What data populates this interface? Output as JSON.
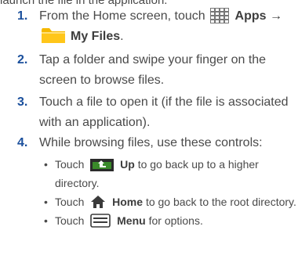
{
  "top_partial_line": "launch the file in the application.",
  "steps": [
    {
      "number": "1.",
      "text_before": "From the Home screen, touch",
      "apps_label": "Apps",
      "arrow": "→",
      "folder_label": "My Files",
      "folder_suffix": "."
    },
    {
      "number": "2.",
      "text": "Tap a folder and swipe your finger on the screen to browse files."
    },
    {
      "number": "3.",
      "text": "Touch a file to open it (if the file is associated with an application)."
    },
    {
      "number": "4.",
      "text": "While browsing files, use these controls:",
      "controls": [
        {
          "bullet": "•",
          "prefix": "Touch",
          "label": "Up",
          "text": "to go back up to a higher directory.",
          "icon": "up-folder-icon"
        },
        {
          "bullet": "•",
          "prefix": "Touch",
          "label": "Home",
          "text": "to go back to the root directory.",
          "icon": "home-icon"
        },
        {
          "bullet": "•",
          "prefix": "Touch",
          "label": "Menu",
          "text": "for options.",
          "icon": "menu-icon"
        }
      ]
    }
  ],
  "colors": {
    "step_number": "#1a4f9c",
    "body_text": "#4a4a4a",
    "folder_yellow": "#f5b800",
    "up_icon_dark": "#2b2b2b",
    "up_icon_green": "#3a8a2a"
  }
}
